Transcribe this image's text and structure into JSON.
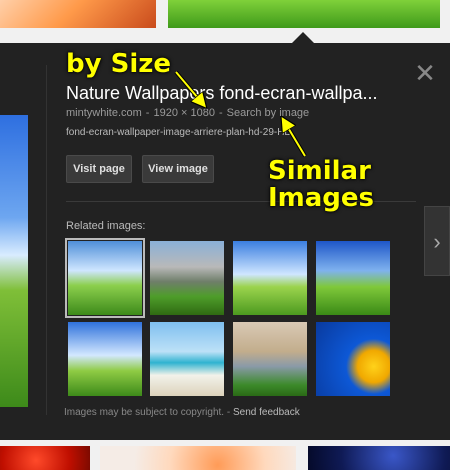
{
  "panel": {
    "title": "Nature Wallpapers fond-ecran-wallpa...",
    "domain": "mintywhite.com",
    "separator": "-",
    "dimensions": "1920 × 1080",
    "search_by_image": "Search by image",
    "description": "fond-ecran-wallpaper-image-arriere-plan-hd-29-HD",
    "visit_page": "Visit page",
    "view_image": "View image",
    "related_label": "Related images:",
    "footer_text": "Images may be subject to copyright.",
    "footer_separator": "-",
    "send_feedback": "Send feedback",
    "close_glyph": "✕",
    "next_glyph": "›"
  },
  "annotations": {
    "by_size": "by Size",
    "similar_line1": "Similar",
    "similar_line2": "Images",
    "color": "#ffff00"
  },
  "related_images": [
    {
      "name": "green-hill-landscape",
      "selected": true
    },
    {
      "name": "mountain-meadow",
      "selected": false
    },
    {
      "name": "grassy-hill-tree",
      "selected": false
    },
    {
      "name": "green-field-blue-sky",
      "selected": false
    },
    {
      "name": "rolling-green-hills",
      "selected": false
    },
    {
      "name": "tropical-beach",
      "selected": false
    },
    {
      "name": "apartment-buildings",
      "selected": false
    },
    {
      "name": "sunflower-blue-sky",
      "selected": false
    }
  ]
}
